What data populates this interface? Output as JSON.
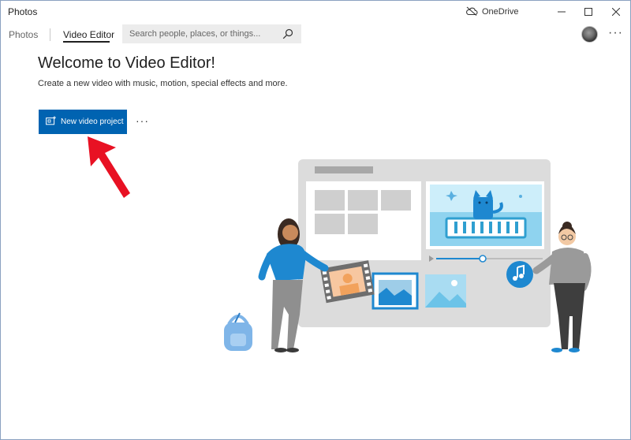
{
  "window": {
    "title": "Photos",
    "onedrive_label": "OneDrive"
  },
  "toolbar": {
    "tabs": [
      {
        "label": "Photos",
        "active": false
      },
      {
        "label": "Video Editor",
        "active": true
      }
    ],
    "search": {
      "placeholder": "Search people, places, or things..."
    }
  },
  "main": {
    "heading": "Welcome to Video Editor!",
    "subtitle": "Create a new video with music, motion, special effects and more.",
    "new_project_label": "New video project"
  },
  "colors": {
    "accent": "#0063b1",
    "annotation_arrow": "#e81123"
  }
}
